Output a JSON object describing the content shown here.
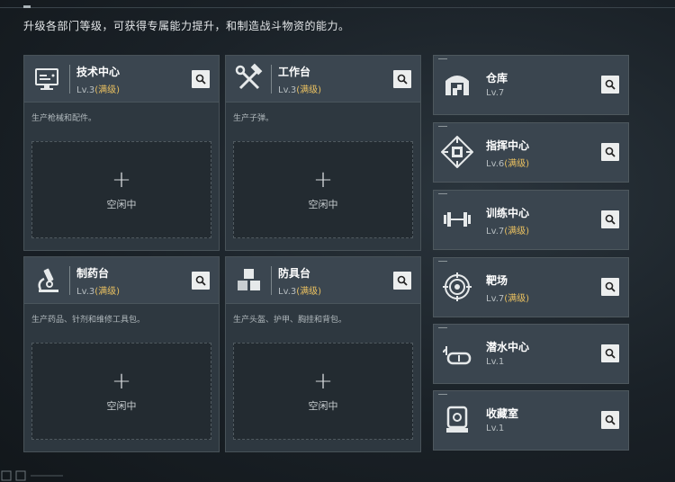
{
  "subtitle": "升级各部门等级，可获得专属能力提升，和制造战斗物资的能力。",
  "colors": {
    "maxed": "#e9c060",
    "background": "#1a2127",
    "card": "#2e3840"
  },
  "facilities": [
    {
      "name": "技术中心",
      "level": "Lv.3",
      "status": "(满级)",
      "description": "生产枪械和配件。",
      "slot_label": "空闲中",
      "icon": "computer-icon"
    },
    {
      "name": "工作台",
      "level": "Lv.3",
      "status": "(满级)",
      "description": "生产子弹。",
      "slot_label": "空闲中",
      "icon": "hammer-wrench-icon"
    },
    {
      "name": "制药台",
      "level": "Lv.3",
      "status": "(满级)",
      "description": "生产药品、针剂和维修工具包。",
      "slot_label": "空闲中",
      "icon": "microscope-icon"
    },
    {
      "name": "防具台",
      "level": "Lv.3",
      "status": "(满级)",
      "description": "生产头盔、护甲、胸挂和背包。",
      "slot_label": "空闲中",
      "icon": "cubes-icon"
    }
  ],
  "side_facilities": [
    {
      "name": "仓库",
      "level": "Lv.7",
      "status": "",
      "icon": "warehouse-icon"
    },
    {
      "name": "指挥中心",
      "level": "Lv.6",
      "status": "(满级)",
      "icon": "chip-icon"
    },
    {
      "name": "训练中心",
      "level": "Lv.7",
      "status": "(满级)",
      "icon": "dumbbell-icon"
    },
    {
      "name": "靶场",
      "level": "Lv.7",
      "status": "(满级)",
      "icon": "target-icon"
    },
    {
      "name": "潜水中心",
      "level": "Lv.1",
      "status": "",
      "icon": "diving-mask-icon"
    },
    {
      "name": "收藏室",
      "level": "Lv.1",
      "status": "",
      "icon": "display-case-icon"
    }
  ]
}
